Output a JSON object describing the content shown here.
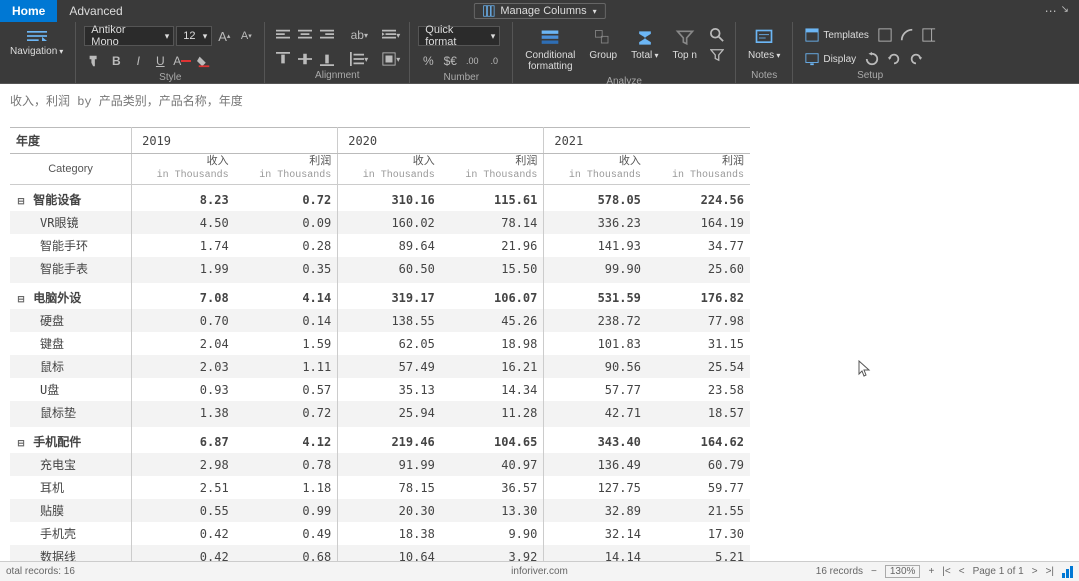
{
  "tabs": {
    "home": "Home",
    "advanced": "Advanced"
  },
  "manage_columns": "Manage Columns",
  "ribbon": {
    "nav": "Navigation",
    "font_family": "Antikor Mono",
    "font_size": "12",
    "quick_format": "Quick format",
    "conditional": "Conditional\nformatting",
    "group": "Group",
    "total": "Total",
    "topn": "Top n",
    "notes": "Notes",
    "templates": "Templates",
    "display": "Display",
    "g_style": "Style",
    "g_alignment": "Alignment",
    "g_number": "Number",
    "g_analyze": "Analyze",
    "g_notes": "Notes",
    "g_setup": "Setup"
  },
  "report": {
    "title": "收入，利润 by 产品类别，产品名称，年度",
    "row_head": "年度",
    "cat_head": "Category",
    "years": [
      "2019",
      "2020",
      "2021"
    ],
    "measures": [
      "收入",
      "利润"
    ],
    "unit": "in Thousands",
    "groups": [
      {
        "name": "智能设备",
        "totals": [
          "8.23",
          "0.72",
          "310.16",
          "115.61",
          "578.05",
          "224.56"
        ],
        "rows": [
          {
            "name": "VR眼镜",
            "vals": [
              "4.50",
              "0.09",
              "160.02",
              "78.14",
              "336.23",
              "164.19"
            ]
          },
          {
            "name": "智能手环",
            "vals": [
              "1.74",
              "0.28",
              "89.64",
              "21.96",
              "141.93",
              "34.77"
            ]
          },
          {
            "name": "智能手表",
            "vals": [
              "1.99",
              "0.35",
              "60.50",
              "15.50",
              "99.90",
              "25.60"
            ]
          }
        ]
      },
      {
        "name": "电脑外设",
        "totals": [
          "7.08",
          "4.14",
          "319.17",
          "106.07",
          "531.59",
          "176.82"
        ],
        "rows": [
          {
            "name": "硬盘",
            "vals": [
              "0.70",
              "0.14",
              "138.55",
              "45.26",
              "238.72",
              "77.98"
            ]
          },
          {
            "name": "键盘",
            "vals": [
              "2.04",
              "1.59",
              "62.05",
              "18.98",
              "101.83",
              "31.15"
            ]
          },
          {
            "name": "鼠标",
            "vals": [
              "2.03",
              "1.11",
              "57.49",
              "16.21",
              "90.56",
              "25.54"
            ]
          },
          {
            "name": "U盘",
            "vals": [
              "0.93",
              "0.57",
              "35.13",
              "14.34",
              "57.77",
              "23.58"
            ]
          },
          {
            "name": "鼠标垫",
            "vals": [
              "1.38",
              "0.72",
              "25.94",
              "11.28",
              "42.71",
              "18.57"
            ]
          }
        ]
      },
      {
        "name": "手机配件",
        "totals": [
          "6.87",
          "4.12",
          "219.46",
          "104.65",
          "343.40",
          "164.62"
        ],
        "rows": [
          {
            "name": "充电宝",
            "vals": [
              "2.98",
              "0.78",
              "91.99",
              "40.97",
              "136.49",
              "60.79"
            ]
          },
          {
            "name": "耳机",
            "vals": [
              "2.51",
              "1.18",
              "78.15",
              "36.57",
              "127.75",
              "59.77"
            ]
          },
          {
            "name": "贴膜",
            "vals": [
              "0.55",
              "0.99",
              "20.30",
              "13.30",
              "32.89",
              "21.55"
            ]
          },
          {
            "name": "手机壳",
            "vals": [
              "0.42",
              "0.49",
              "18.38",
              "9.90",
              "32.14",
              "17.30"
            ]
          },
          {
            "name": "数据线",
            "vals": [
              "0.42",
              "0.68",
              "10.64",
              "3.92",
              "14.14",
              "5.21"
            ]
          }
        ]
      }
    ]
  },
  "status": {
    "total": "otal records: 16",
    "site": "inforiver.com",
    "records": "16 records",
    "zoom": "130%",
    "page": "Page 1 of 1"
  }
}
